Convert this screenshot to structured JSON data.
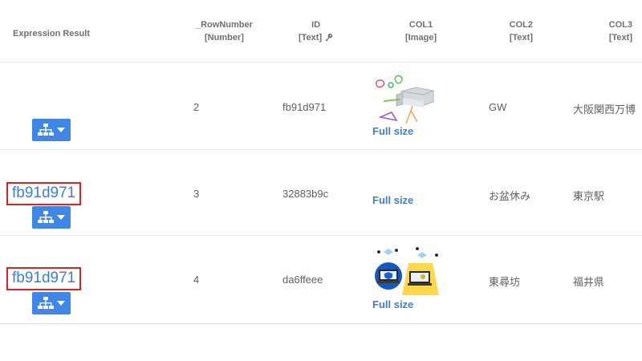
{
  "header": {
    "expression_result": "Expression Result",
    "rownumber": {
      "name": "_RowNumber",
      "type": "[Number]"
    },
    "id": {
      "name": "ID",
      "type": "[Text]"
    },
    "col1": {
      "name": "COL1",
      "type": "[Image]"
    },
    "col2": {
      "name": "COL2",
      "type": "[Text]"
    },
    "col3": {
      "name": "COL3",
      "type": "[Text]"
    }
  },
  "rows": [
    {
      "expression": "",
      "rownumber": "2",
      "id": "fb91d971",
      "full_size": "Full size",
      "col2": "GW",
      "col3": "大阪関西万博"
    },
    {
      "expression": "fb91d971",
      "rownumber": "3",
      "id": "32883b9c",
      "full_size": "Full size",
      "col2": "お盆休み",
      "col3": "東京駅"
    },
    {
      "expression": "fb91d971",
      "rownumber": "4",
      "id": "da6ffeee",
      "full_size": "Full size",
      "col2": "東尋坊",
      "col3": "福井県"
    }
  ],
  "icons": {
    "tree": "hierarchy-tree-icon",
    "dropdown": "caret-down-icon",
    "key": "key-icon"
  },
  "colors": {
    "accent": "#3e86e8",
    "link": "#3b7de0",
    "highlight": "#e02020"
  }
}
